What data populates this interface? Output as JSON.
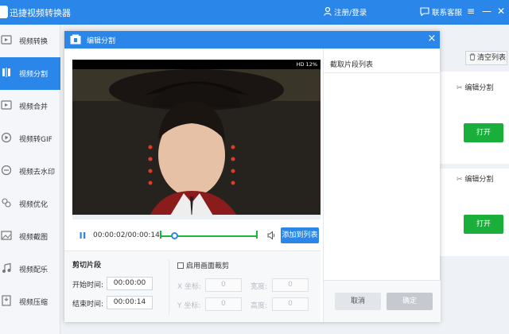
{
  "app": {
    "title": "迅捷视频转换器",
    "login_label": "注册/登录",
    "service_label": "联系客服",
    "window_controls": [
      "≡",
      "—",
      "✕"
    ]
  },
  "sidebar": {
    "items": [
      {
        "label": "视频转换",
        "icon": "video-convert-icon"
      },
      {
        "label": "视频分割",
        "icon": "video-split-icon",
        "active": true
      },
      {
        "label": "视频合并",
        "icon": "video-merge-icon"
      },
      {
        "label": "视频转GIF",
        "icon": "gif-icon"
      },
      {
        "label": "视频去水印",
        "icon": "watermark-icon"
      },
      {
        "label": "视频优化",
        "icon": "optimize-icon"
      },
      {
        "label": "视频截图",
        "icon": "screenshot-icon"
      },
      {
        "label": "视频配乐",
        "icon": "music-icon"
      },
      {
        "label": "视频压缩",
        "icon": "compress-icon"
      }
    ]
  },
  "background": {
    "clear_list_label": "清空列表",
    "split_label": "编辑分割",
    "open_label": "打开"
  },
  "dialog": {
    "title": "编辑分割",
    "close_label": "×",
    "video_status": "HD 12%",
    "player": {
      "timecode": "00:00:02/00:00:14",
      "progress": 0.15,
      "add_to_list_label": "添加到列表"
    },
    "cut": {
      "title": "剪切片段",
      "start_label": "开始时间:",
      "start_value": "00:00:00",
      "end_label": "结束时间:",
      "end_value": "00:00:14",
      "crop_label": "启用画面裁剪",
      "x_label": "X 坐标:",
      "y_label": "Y 坐标:",
      "width_label": "宽度:",
      "height_label": "高度:",
      "x_value": "0",
      "y_value": "0",
      "width_value": "0",
      "height_value": "0"
    },
    "right_panel": {
      "title": "截取片段列表",
      "cancel_label": "取消",
      "ok_label": "确定"
    }
  },
  "colors": {
    "brand": "#2b86ea",
    "green": "#1aaf3b",
    "track": "#19b53c"
  }
}
